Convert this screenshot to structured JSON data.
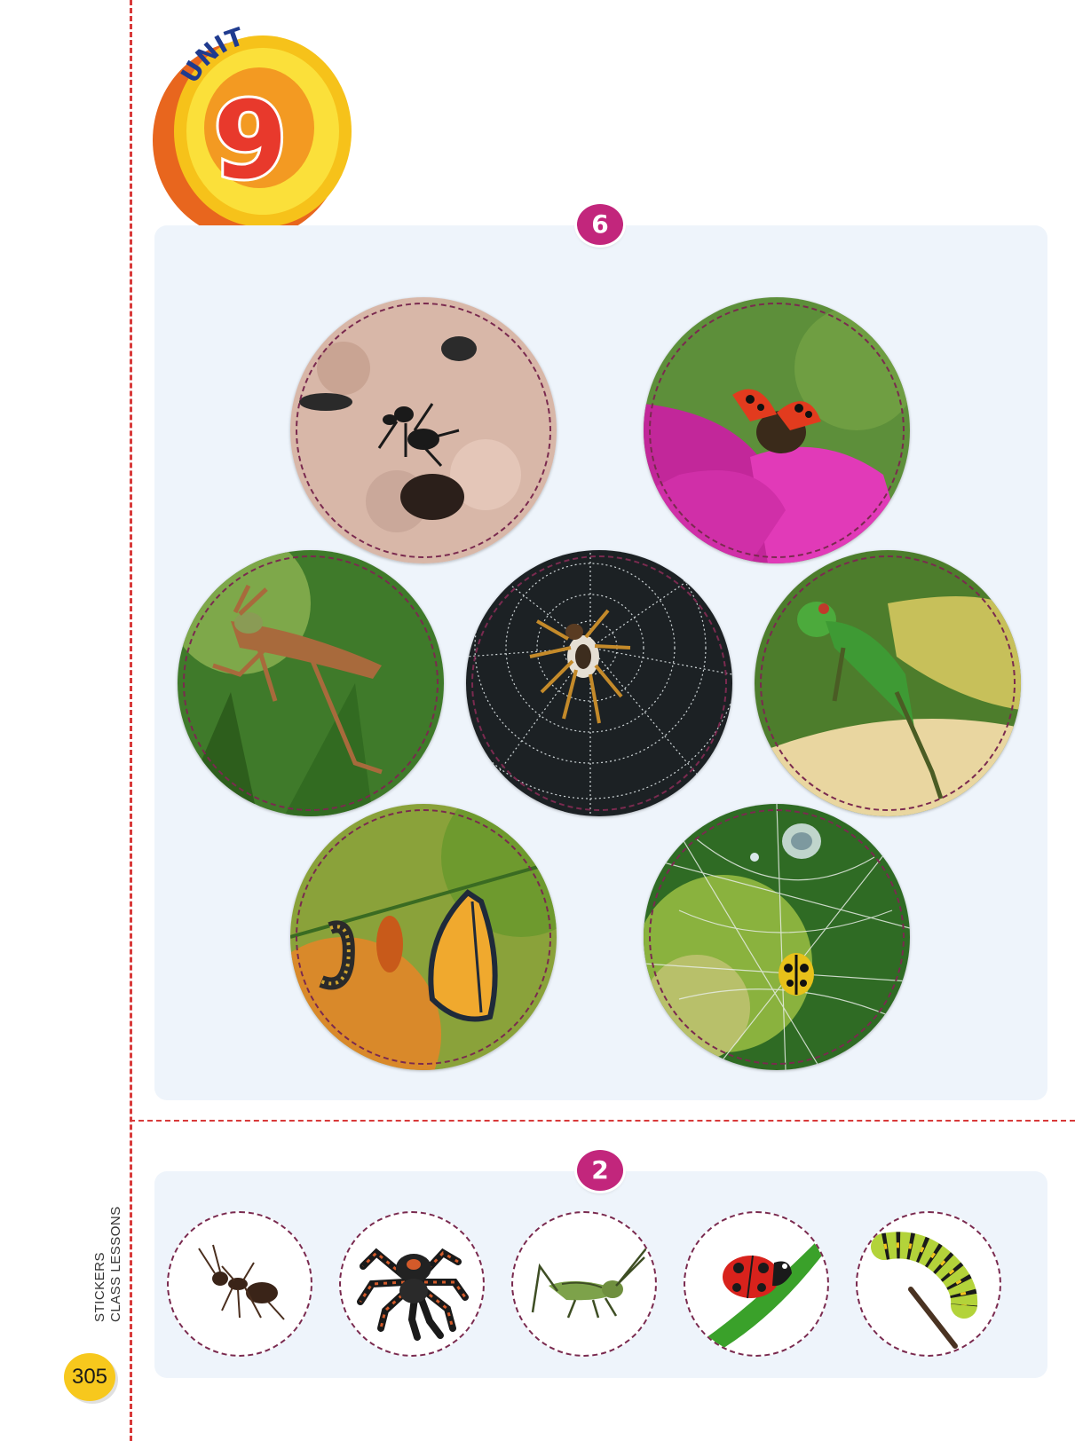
{
  "unit_badge": {
    "label": "UNIT",
    "number": "9"
  },
  "sections": {
    "top": {
      "count": "6",
      "photos": [
        {
          "name": "ants-at-nest-hole",
          "icon": "ant-photo"
        },
        {
          "name": "ladybug-on-flower",
          "icon": "ladybug-photo"
        },
        {
          "name": "grasshopper-jumping",
          "icon": "grasshopper-photo"
        },
        {
          "name": "spider-in-web",
          "icon": "spider-photo"
        },
        {
          "name": "green-grasshopper-flying",
          "icon": "grasshopper-photo"
        },
        {
          "name": "caterpillar-chrysalis-butterfly",
          "icon": "butterfly-lifecycle-photo"
        },
        {
          "name": "beetle-in-web",
          "icon": "beetle-photo"
        }
      ]
    },
    "bottom": {
      "count": "2",
      "stickers": [
        {
          "name": "ant",
          "icon": "ant-icon"
        },
        {
          "name": "tarantula",
          "icon": "spider-icon"
        },
        {
          "name": "cricket",
          "icon": "cricket-icon"
        },
        {
          "name": "ladybug",
          "icon": "ladybug-icon"
        },
        {
          "name": "caterpillar",
          "icon": "caterpillar-icon"
        }
      ]
    }
  },
  "side_label": {
    "line1": "STICKERS",
    "line2": "CLASS LESSONS"
  },
  "page_number": "305",
  "colors": {
    "cut_line": "#d83a3a",
    "badge": "#c2267c",
    "panel": "#eef4fb",
    "page_dot": "#f7c81d"
  }
}
